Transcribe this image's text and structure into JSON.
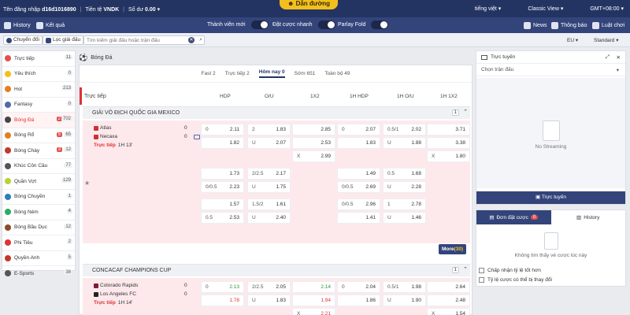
{
  "account": {
    "label": "Tên đăng nhập",
    "user": "d16d1016890",
    "currency_label": "Tiền tệ",
    "currency": "VNDK",
    "balance_label": "Số dư",
    "balance": "0.00"
  },
  "brand": {
    "label": "Dẫn đường"
  },
  "topright": {
    "lang": "tiếng việt",
    "view": "Classic View",
    "tz": "GMT+08:00"
  },
  "nav": {
    "history": "History",
    "result": "Kết quả",
    "new_members": "Thành viên mới",
    "quick_bet": "Đặt cược nhanh",
    "parlay": "Parlay Fold",
    "news": "News",
    "notice": "Thông báo",
    "rules": "Luật chơi"
  },
  "toolbar": {
    "switch": "Chuyển đổi",
    "filter": "Lọc giải đấu",
    "search_placeholder": "Tìm kiếm giải đấu hoặc trận đấu",
    "region": "EU",
    "odds_type": "Standard"
  },
  "sidebar": [
    {
      "label": "Trực tiếp",
      "count": "11",
      "color": "#e25050"
    },
    {
      "label": "Yêu thích",
      "count": "0",
      "color": "#f2c01e"
    },
    {
      "label": "Hot",
      "count": "213",
      "color": "#e67e22"
    },
    {
      "label": "Fantasy",
      "count": "0",
      "color": "#5566aa"
    },
    {
      "label": "Bóng Đá",
      "live": "2",
      "count": "702",
      "color": "#444"
    },
    {
      "label": "Bóng Rổ",
      "live": "5",
      "count": "65",
      "color": "#e67e22"
    },
    {
      "label": "Bóng Chày",
      "live": "3",
      "count": "12",
      "color": "#c0392b"
    },
    {
      "label": "Khúc Côn Cầu",
      "count": "77",
      "color": "#555"
    },
    {
      "label": "Quần Vợt",
      "count": "129",
      "color": "#b7d334"
    },
    {
      "label": "Bóng Chuyền",
      "count": "1",
      "color": "#2980b9"
    },
    {
      "label": "Bóng Ném",
      "count": "4",
      "color": "#27ae60"
    },
    {
      "label": "Bóng Bầu Dục",
      "count": "12",
      "color": "#8e4a2a"
    },
    {
      "label": "Phi Tiêu",
      "count": "2",
      "color": "#d33"
    },
    {
      "label": "Quyền Anh",
      "count": "5",
      "color": "#c0392b"
    },
    {
      "label": "E-Sports",
      "count": "38",
      "color": "#555"
    }
  ],
  "main": {
    "title": "Bóng Đá",
    "tabs": [
      "Fast 2",
      "Trực tiếp 2",
      "Hôm nay 0",
      "Sớm 651",
      "Toàn bộ 49"
    ],
    "headers": {
      "live": "Trực tiếp",
      "hdp": "HDP",
      "ou": "O/U",
      "x12": "1X2",
      "h1hdp": "1H HDP",
      "h1ou": "1H O/U",
      "h112": "1H 1X2"
    },
    "league1": {
      "name": "GIẢI VÔ ĐỊCH QUỐC GIA MEXICO",
      "count": "1"
    },
    "league2": {
      "name": "CONCACAF CHAMPIONS CUP",
      "count": "1"
    },
    "m1": {
      "home": "Atlas",
      "away": "Necaxa",
      "hs": "0",
      "as": "0",
      "status": "Trực tiếp",
      "time": "1H 13'"
    },
    "m2": {
      "home": "Colorado Rapids",
      "away": "Los Angeles FC",
      "hs": "0",
      "as": "0",
      "status": "Trực tiếp",
      "time": "1H 14'"
    },
    "more": {
      "label": "More",
      "count": "(30)"
    }
  },
  "right": {
    "live_title": "Trực tuyến",
    "match_select": "Chọn trận đấu",
    "no_stream": "No Streaming",
    "live_btn": "Trực tuyến",
    "slip_tab": "Đơn đặt cược",
    "slip_count": "0",
    "history_tab": "History",
    "no_slip": "Không tìm thấy vé cược lúc này",
    "opt1": "Chấp nhận tỷ lệ tốt hơn",
    "opt2": "Tỷ lệ cược có thể bị thay đổi"
  }
}
